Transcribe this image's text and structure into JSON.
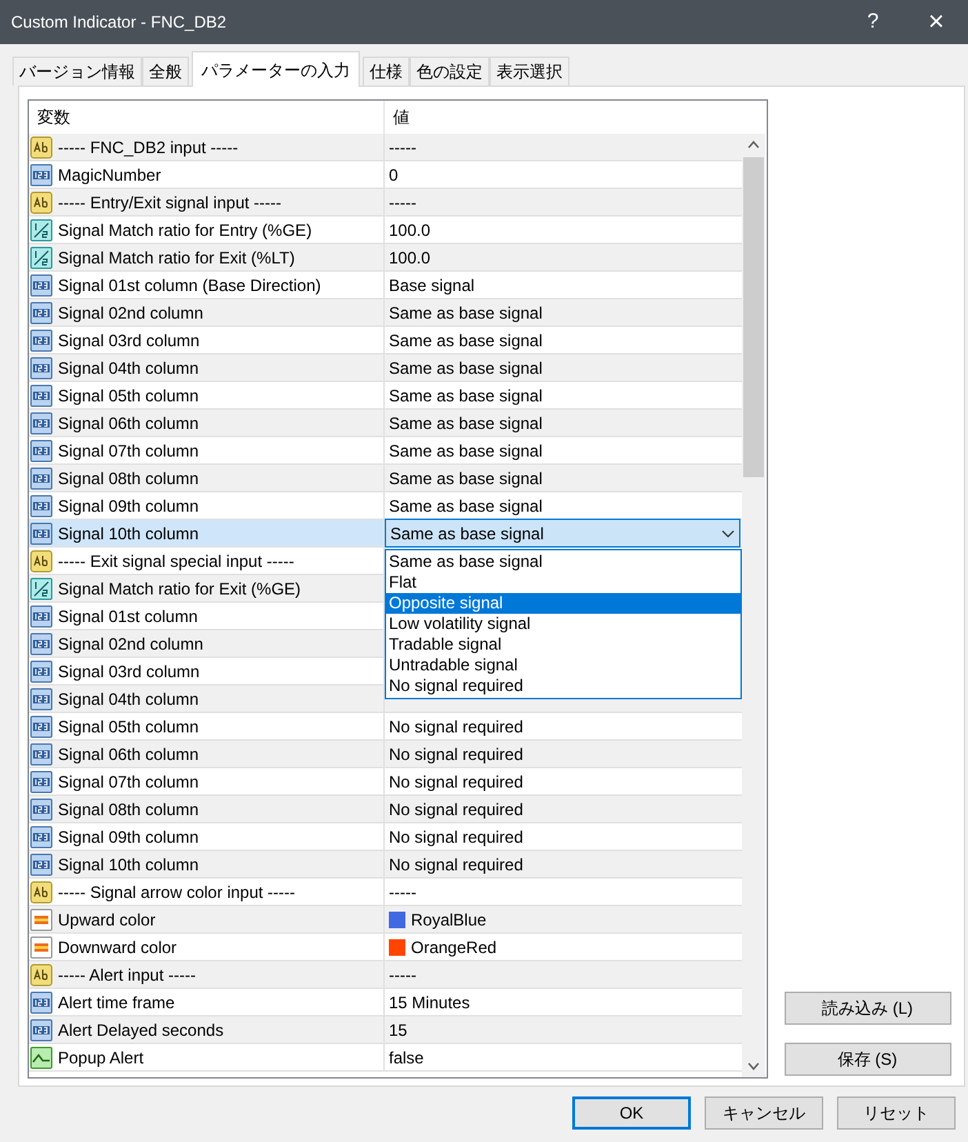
{
  "window": {
    "title": "Custom Indicator - FNC_DB2",
    "help": "?",
    "close": "×"
  },
  "tabs": [
    {
      "label": "バージョン情報",
      "selected": false
    },
    {
      "label": "全般",
      "selected": false
    },
    {
      "label": "パラメーターの入力",
      "selected": true
    },
    {
      "label": "仕様",
      "selected": false
    },
    {
      "label": "色の設定",
      "selected": false
    },
    {
      "label": "表示選択",
      "selected": false
    }
  ],
  "table": {
    "columns": [
      "変数",
      "値"
    ],
    "rows": [
      {
        "kind": "text",
        "name": "----- FNC_DB2 input -----",
        "value": "-----",
        "selected": false
      },
      {
        "kind": "int",
        "name": "MagicNumber",
        "value": "0",
        "selected": false
      },
      {
        "kind": "text",
        "name": "----- Entry/Exit signal input -----",
        "value": "-----",
        "selected": false
      },
      {
        "kind": "double",
        "name": "Signal Match ratio for Entry (%GE)",
        "value": "100.0",
        "selected": false
      },
      {
        "kind": "double",
        "name": "Signal Match ratio for Exit (%LT)",
        "value": "100.0",
        "selected": false
      },
      {
        "kind": "int",
        "name": "Signal 01st column (Base Direction)",
        "value": "Base signal",
        "selected": false
      },
      {
        "kind": "int",
        "name": "Signal 02nd column",
        "value": "Same as base signal",
        "selected": false
      },
      {
        "kind": "int",
        "name": "Signal 03rd column",
        "value": "Same as base signal",
        "selected": false
      },
      {
        "kind": "int",
        "name": "Signal 04th column",
        "value": "Same as base signal",
        "selected": false
      },
      {
        "kind": "int",
        "name": "Signal 05th column",
        "value": "Same as base signal",
        "selected": false
      },
      {
        "kind": "int",
        "name": "Signal 06th column",
        "value": "Same as base signal",
        "selected": false
      },
      {
        "kind": "int",
        "name": "Signal 07th column",
        "value": "Same as base signal",
        "selected": false
      },
      {
        "kind": "int",
        "name": "Signal 08th column",
        "value": "Same as base signal",
        "selected": false
      },
      {
        "kind": "int",
        "name": "Signal 09th column",
        "value": "Same as base signal",
        "selected": false
      },
      {
        "kind": "int",
        "name": "Signal 10th column",
        "value": "Same as base signal",
        "selected": true
      },
      {
        "kind": "text",
        "name": "----- Exit signal special input -----",
        "selected": false
      },
      {
        "kind": "double",
        "name": "Signal Match ratio for Exit (%GE)",
        "selected": false
      },
      {
        "kind": "int",
        "name": "Signal 01st column",
        "selected": false
      },
      {
        "kind": "int",
        "name": "Signal 02nd column",
        "selected": false
      },
      {
        "kind": "int",
        "name": "Signal 03rd column",
        "selected": false
      },
      {
        "kind": "int",
        "name": "Signal 04th column",
        "selected": false
      },
      {
        "kind": "int",
        "name": "Signal 05th column",
        "value": "No signal required",
        "selected": false
      },
      {
        "kind": "int",
        "name": "Signal 06th column",
        "value": "No signal required",
        "selected": false
      },
      {
        "kind": "int",
        "name": "Signal 07th column",
        "value": "No signal required",
        "selected": false
      },
      {
        "kind": "int",
        "name": "Signal 08th column",
        "value": "No signal required",
        "selected": false
      },
      {
        "kind": "int",
        "name": "Signal 09th column",
        "value": "No signal required",
        "selected": false
      },
      {
        "kind": "int",
        "name": "Signal 10th column",
        "value": "No signal required",
        "selected": false
      },
      {
        "kind": "text",
        "name": "----- Signal arrow color input -----",
        "value": "-----",
        "selected": false
      },
      {
        "kind": "color",
        "name": "Upward color",
        "value": "RoyalBlue",
        "color": "#4169e1",
        "selected": false
      },
      {
        "kind": "color",
        "name": "Downward color",
        "value": "OrangeRed",
        "color": "#ff4500",
        "selected": false
      },
      {
        "kind": "text",
        "name": "----- Alert input -----",
        "value": "-----",
        "selected": false
      },
      {
        "kind": "int",
        "name": "Alert time frame",
        "value": "15 Minutes",
        "selected": false
      },
      {
        "kind": "int",
        "name": "Alert Delayed seconds",
        "value": "15",
        "selected": false
      },
      {
        "kind": "bool",
        "name": "Popup Alert",
        "value": "false",
        "selected": false
      }
    ]
  },
  "dropdown": {
    "options": [
      {
        "label": "Same as base signal",
        "selected": false
      },
      {
        "label": "Flat",
        "selected": false
      },
      {
        "label": "Opposite signal",
        "selected": true
      },
      {
        "label": "Low volatility signal",
        "selected": false
      },
      {
        "label": "Tradable signal",
        "selected": false
      },
      {
        "label": "Untradable signal",
        "selected": false
      },
      {
        "label": "No signal required",
        "selected": false
      }
    ]
  },
  "side_buttons": [
    "読み込み (L)",
    "保存 (S)"
  ],
  "buttons": [
    "OK",
    "キャンセル",
    "リセット"
  ]
}
